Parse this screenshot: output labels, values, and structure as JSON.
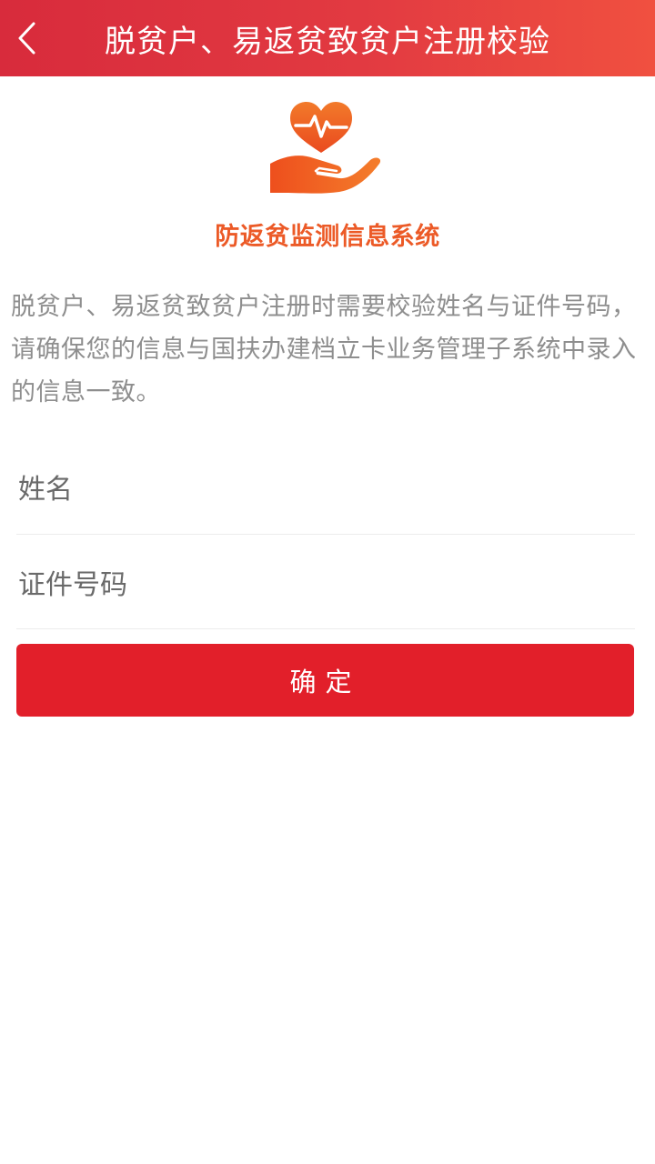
{
  "header": {
    "title": "脱贫户、易返贫致贫户注册校验",
    "back_icon": "chevron-left-icon"
  },
  "logo": {
    "icon": "heart-pulse-hand-icon",
    "system_name": "防返贫监测信息系统"
  },
  "description": "脱贫户、易返贫致贫户注册时需要校验姓名与证件号码，请确保您的信息与国扶办建档立卡业务管理子系统中录入的信息一致。",
  "form": {
    "name_placeholder": "姓名",
    "id_placeholder": "证件号码",
    "name_value": "",
    "id_value": ""
  },
  "confirm_button": {
    "label": "确定"
  },
  "colors": {
    "header_start": "#d82b3c",
    "header_end": "#f05040",
    "brand_orange": "#ec5a27",
    "button_red": "#e21f2a"
  }
}
